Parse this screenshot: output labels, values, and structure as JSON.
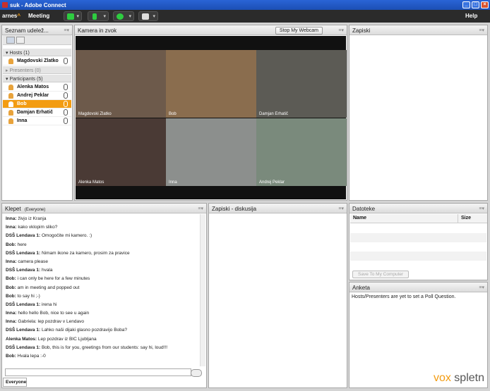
{
  "window": {
    "title": "suk - Adobe Connect"
  },
  "menubar": {
    "logo_prefix": "arnes",
    "logo_suffix": "",
    "meeting_label": "Meeting",
    "help_label": "Help",
    "speaker_color": "#2ecc40",
    "mic_color": "#2ecc40",
    "camera_color": "#2ecc40"
  },
  "attendees": {
    "title": "Seznam udelež...",
    "groups": {
      "hosts": "Hosts (1)",
      "presenters": "Presenters (0)",
      "participants": "Participants (5)"
    },
    "hosts": [
      "Magdovski Zlatko"
    ],
    "participants": [
      "Alenka Matos",
      "Andrej Peklar",
      "Bob",
      "Damjan Erhatič",
      "Inna"
    ],
    "selected": "Bob"
  },
  "camera": {
    "title": "Kamera in zvok",
    "stop_button": "Stop My Webcam",
    "tiles": [
      {
        "name": "Magdovski Zlatko",
        "color": "#6d5a4b"
      },
      {
        "name": "Bob",
        "color": "#8a6d4e"
      },
      {
        "name": "Damjan Erhatič",
        "color": "#5c5b55"
      },
      {
        "name": "Alenka Matos",
        "color": "#4a3a35"
      },
      {
        "name": "Inna",
        "color": "#8c8f8d"
      },
      {
        "name": "Andrej Peklar",
        "color": "#7a8a7c"
      }
    ]
  },
  "notes": {
    "title": "Zapiski"
  },
  "chat": {
    "title": "Klepet",
    "audience": "(Everyone)",
    "tab": "Everyone",
    "messages": [
      {
        "sender": "Inna:",
        "text": "živjo iz Kranja"
      },
      {
        "sender": "Inna:",
        "text": "kako vklopim sliko?"
      },
      {
        "sender": "DSŠ Lendava 1:",
        "text": "Omogočite mi kamero. :)"
      },
      {
        "sender": "Bob:",
        "text": "here"
      },
      {
        "sender": "DSŠ Lendava 1:",
        "text": "Nimam ikone za kamero, prosim za pravice"
      },
      {
        "sender": "Inna:",
        "text": "camera please"
      },
      {
        "sender": "DSŠ Lendava 1:",
        "text": "hvala"
      },
      {
        "sender": "Bob:",
        "text": "i can only be here for a few minutes"
      },
      {
        "sender": "Bob:",
        "text": "am in meeting and popped out"
      },
      {
        "sender": "Bob:",
        "text": "to say hi ;-)"
      },
      {
        "sender": "DSŠ Lendava 1:",
        "text": "irena hi"
      },
      {
        "sender": "Inna:",
        "text": "hello hello Bob, nice to see u again"
      },
      {
        "sender": "Inna:",
        "text": "Gabriela: lep pozdrav v Lendavo"
      },
      {
        "sender": "DSŠ Lendava 1:",
        "text": "Lahko naši dijaki  glasno pozdravijo Boba?"
      },
      {
        "sender": "Alenka Matos:",
        "text": "Lep pozdrav iz BIC Ljubljana"
      },
      {
        "sender": "DSŠ Lendava 1:",
        "text": "Bob, this is for you, greetings from our students: say hi, loud!!!"
      },
      {
        "sender": "Bob:",
        "text": "Hvala lepa :-0"
      }
    ]
  },
  "discussion": {
    "title": "Zapiski - diskusija"
  },
  "files": {
    "title": "Datoteke",
    "col_name": "Name",
    "col_size": "Size",
    "upload_button": "Save To My Computer"
  },
  "poll": {
    "title": "Anketa",
    "message": "Hosts/Presenters are yet to set a Poll Question."
  },
  "watermark": {
    "prefix": "v",
    "middle": "ox",
    "suffix": " spletn"
  }
}
